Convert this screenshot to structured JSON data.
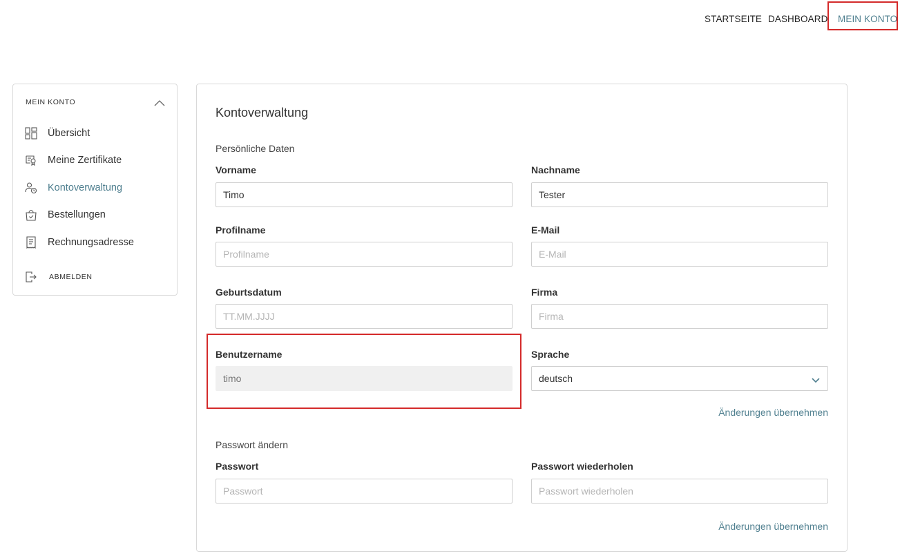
{
  "nav": {
    "startseite": "STARTSEITE",
    "dashboard": "DASHBOARD",
    "mein_konto": "MEIN KONTO",
    "highlight_color": "#d42a2a",
    "accent_color": "#4f7f8f"
  },
  "sidebar": {
    "header": "MEIN KONTO",
    "toggle_icon": "chevron-up-icon",
    "items": [
      {
        "label": "Übersicht",
        "icon": "dashboard-grid-icon",
        "active": false
      },
      {
        "label": "Meine Zertifikate",
        "icon": "certificate-icon",
        "active": false
      },
      {
        "label": "Kontoverwaltung",
        "icon": "user-settings-icon",
        "active": true
      },
      {
        "label": "Bestellungen",
        "icon": "shopping-bag-icon",
        "active": false
      },
      {
        "label": "Rechnungsadresse",
        "icon": "receipt-icon",
        "active": false
      }
    ],
    "logout": {
      "label": "ABMELDEN",
      "icon": "logout-icon"
    }
  },
  "main": {
    "title": "Kontoverwaltung",
    "personal_section": "Persönliche Daten",
    "fields": {
      "vorname": {
        "label": "Vorname",
        "value": "Timo",
        "placeholder": "Vorname"
      },
      "nachname": {
        "label": "Nachname",
        "value": "Tester",
        "placeholder": "Nachname"
      },
      "profilname": {
        "label": "Profilname",
        "value": "",
        "placeholder": "Profilname"
      },
      "email": {
        "label": "E-Mail",
        "value": "",
        "placeholder": "E-Mail"
      },
      "geburtsdatum": {
        "label": "Geburtsdatum",
        "value": "",
        "placeholder": "TT.MM.JJJJ"
      },
      "firma": {
        "label": "Firma",
        "value": "",
        "placeholder": "Firma"
      },
      "benutzername": {
        "label": "Benutzername",
        "value": "timo"
      },
      "sprache": {
        "label": "Sprache",
        "value": "deutsch"
      }
    },
    "apply_label": "Änderungen übernehmen",
    "password_section": "Passwort ändern",
    "password": {
      "label": "Passwort",
      "placeholder": "Passwort"
    },
    "password_repeat": {
      "label": "Passwort wiederholen",
      "placeholder": "Passwort wiederholen"
    },
    "apply_label_2": "Änderungen übernehmen"
  }
}
